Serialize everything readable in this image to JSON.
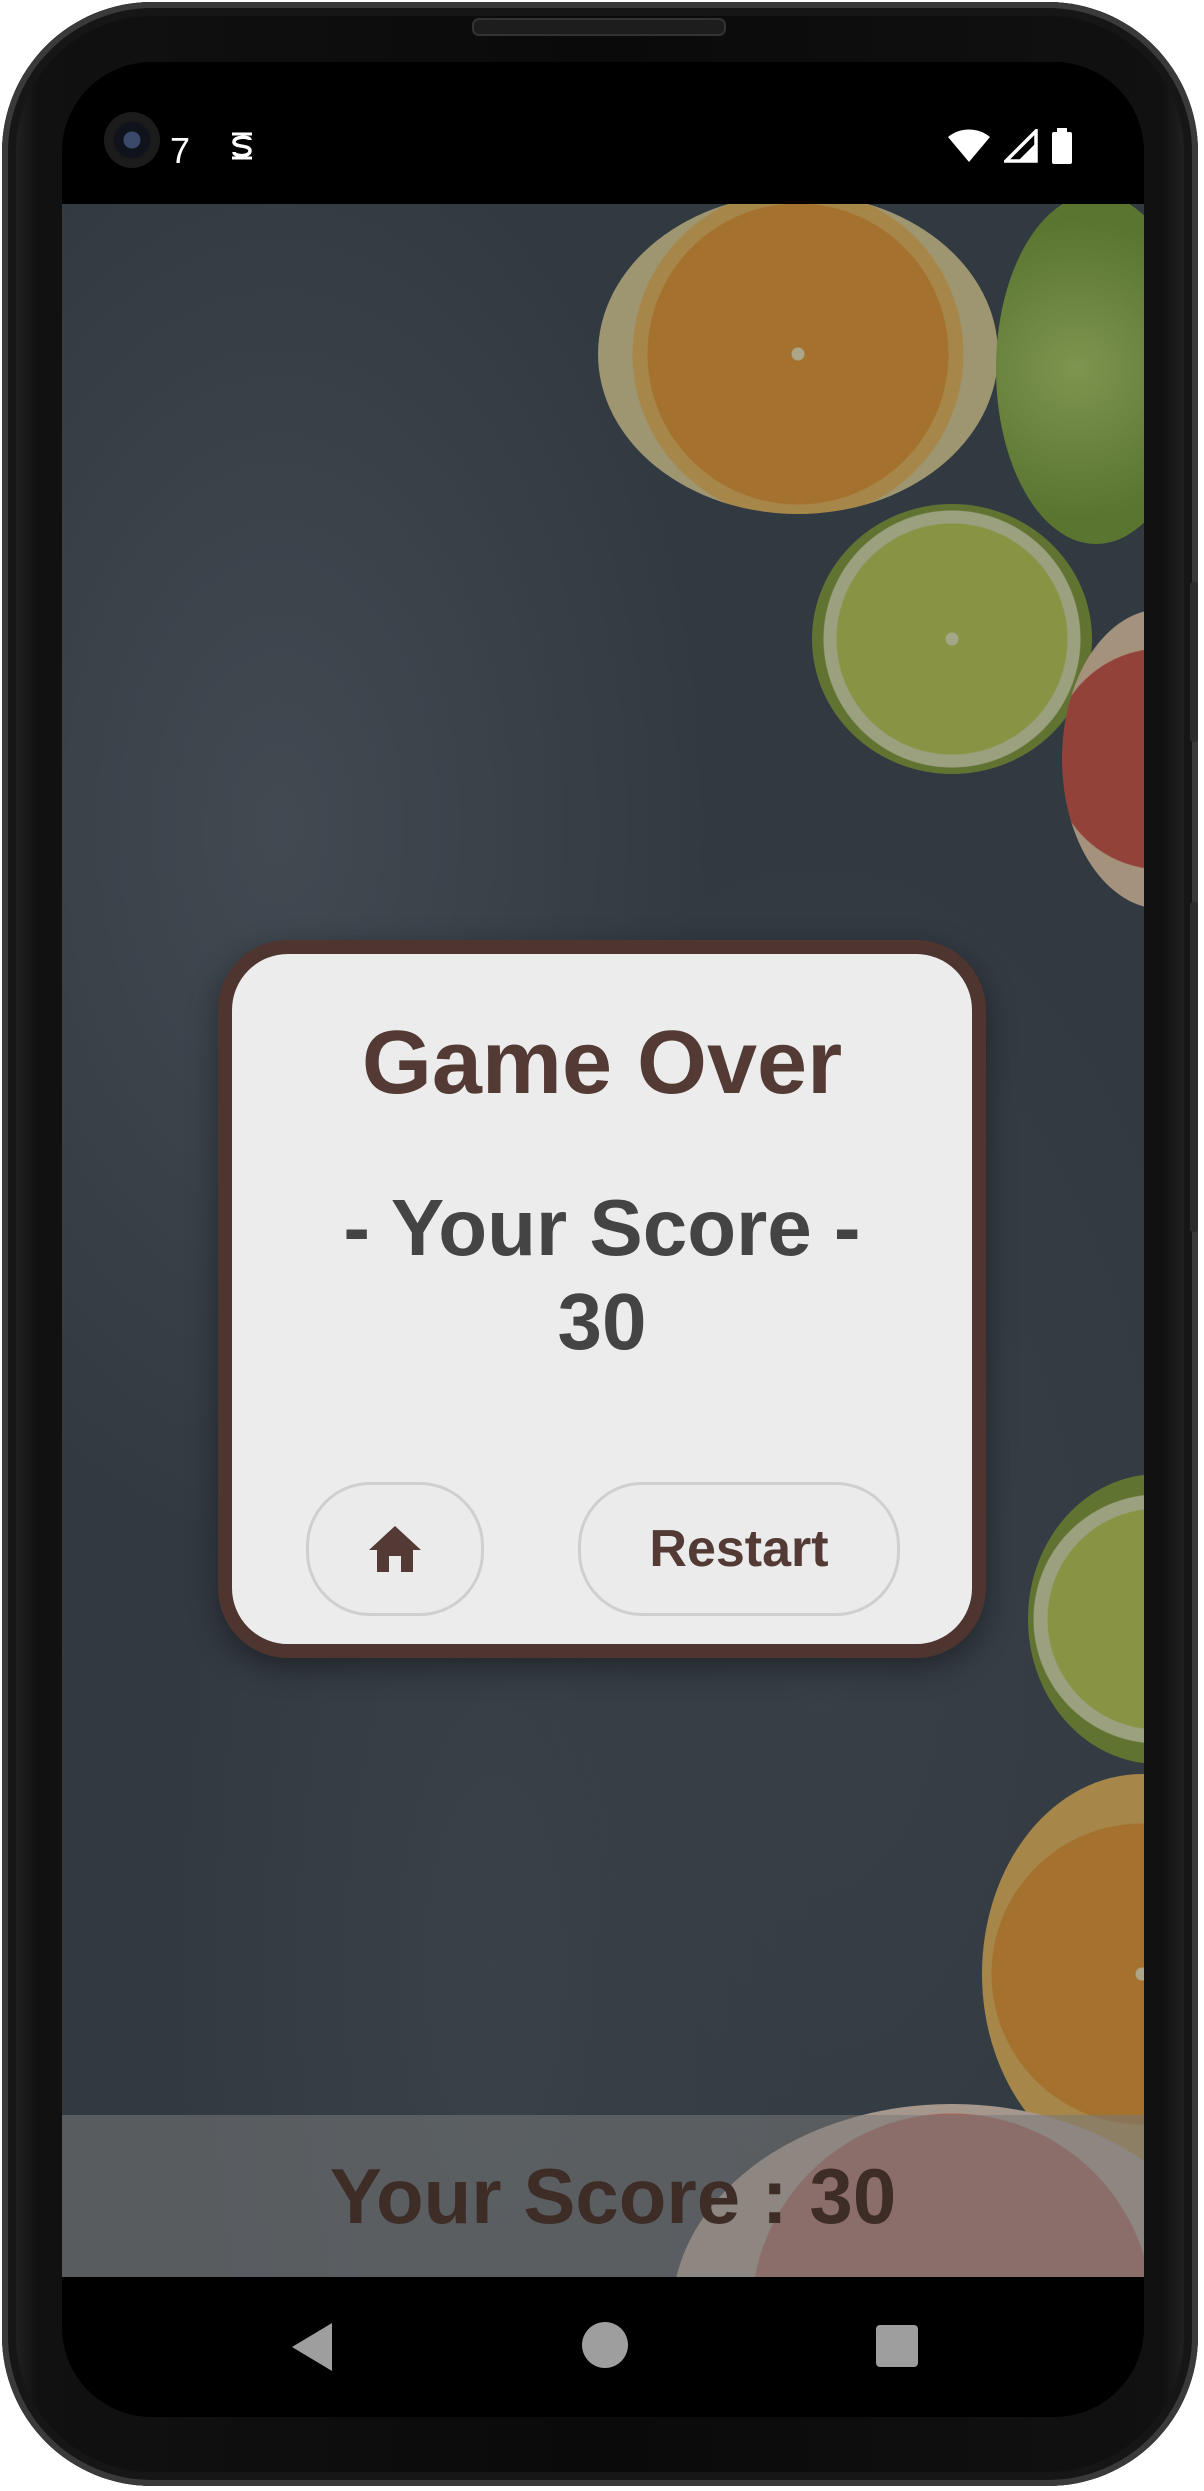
{
  "status_bar": {
    "time": "7",
    "notification_icon": "sync-s-icon",
    "icons": [
      "wifi-icon",
      "cell-signal-icon",
      "battery-icon"
    ]
  },
  "dialog": {
    "title": "Game Over",
    "score_label": "- Your Score -",
    "score_value": "30",
    "home_button_icon": "home-icon",
    "restart_label": "Restart"
  },
  "bottom_bar": {
    "score_text": "Your Score : 30"
  },
  "nav_bar": {
    "icons": [
      "back-icon",
      "home-circle-icon",
      "recents-icon"
    ]
  },
  "colors": {
    "dialog_border": "#4f3530",
    "dialog_background": "#ececec",
    "title_text": "#543a34",
    "score_text": "#444444",
    "background_stone": "#434d57"
  }
}
